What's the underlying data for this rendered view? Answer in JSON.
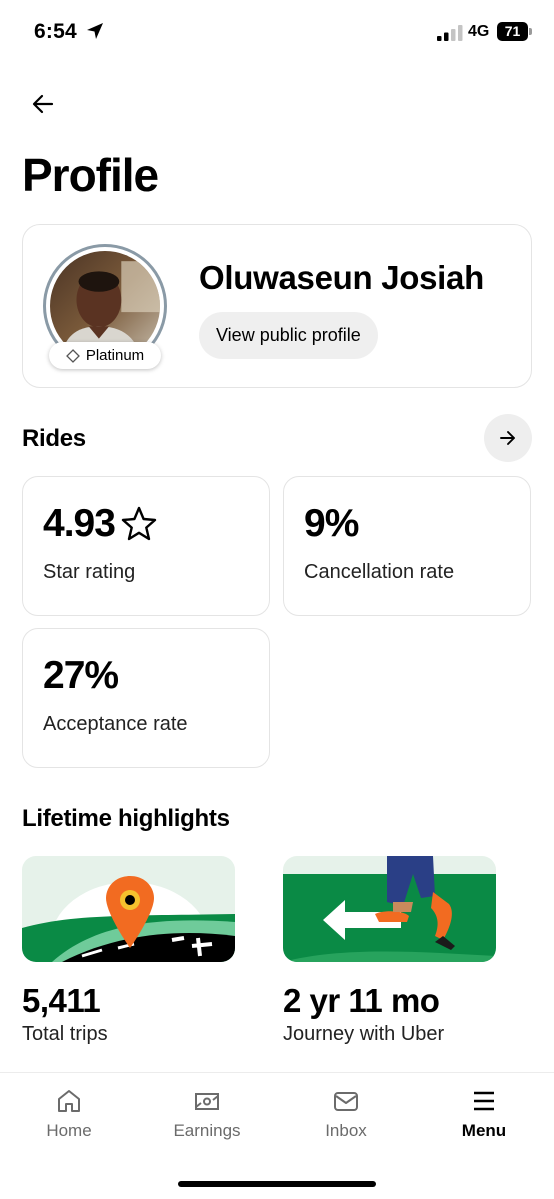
{
  "status_bar": {
    "time": "6:54",
    "network": "4G",
    "battery": "71",
    "icons": [
      "location-arrow-icon",
      "signal-icon",
      "battery-icon"
    ]
  },
  "header": {
    "back_icon": "arrow-left-icon",
    "title": "Profile"
  },
  "profile": {
    "name": "Oluwaseun Josiah",
    "tier": "Platinum",
    "tier_icon": "diamond-outline-icon",
    "public_profile_label": "View public profile"
  },
  "rides": {
    "title": "Rides",
    "arrow_icon": "arrow-right-icon",
    "stats": [
      {
        "value": "4.93",
        "label": "Star rating",
        "icon": "star-outline-icon"
      },
      {
        "value": "9%",
        "label": "Cancellation rate"
      },
      {
        "value": "27%",
        "label": "Acceptance rate"
      }
    ]
  },
  "highlights": {
    "title": "Lifetime highlights",
    "items": [
      {
        "value": "5,411",
        "label": "Total trips",
        "illustration": "map-pin-road-illustration"
      },
      {
        "value": "2 yr 11 mo",
        "label": "Journey with Uber",
        "illustration": "walking-arrow-illustration"
      }
    ]
  },
  "tabs": [
    {
      "label": "Home",
      "icon": "home-icon",
      "active": false
    },
    {
      "label": "Earnings",
      "icon": "money-icon",
      "active": false
    },
    {
      "label": "Inbox",
      "icon": "envelope-icon",
      "active": false
    },
    {
      "label": "Menu",
      "icon": "hamburger-menu-icon",
      "active": true
    }
  ],
  "colors": {
    "accent_green": "#0a8a45",
    "light_green": "#e6f2ea",
    "pin_orange": "#f26b21",
    "chip_grey": "#efefef",
    "border_grey": "#e4e4e4"
  }
}
